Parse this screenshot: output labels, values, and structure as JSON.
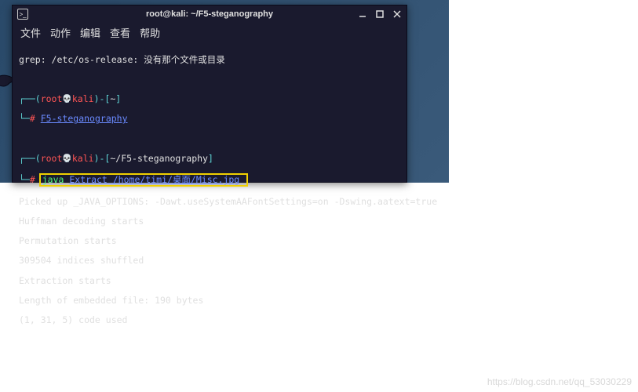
{
  "window": {
    "title": "root@kali: ~/F5-steganography"
  },
  "menu": {
    "file": "文件",
    "action": "动作",
    "edit": "编辑",
    "view": "查看",
    "help": "帮助"
  },
  "terminal": {
    "grep_line": "grep: /etc/os-release: 没有那个文件或目录",
    "prompt1": {
      "user": "root",
      "host": "kali",
      "path": "~",
      "command_prefix": "#",
      "command": "F5-steganography"
    },
    "prompt2": {
      "user": "root",
      "host": "kali",
      "path": "~/F5-steganography",
      "command_prefix": "#",
      "command_java": "java",
      "command_rest": "Extract /home/timi/桌面/Misc.jpg"
    },
    "output": {
      "l1": "Picked up _JAVA_OPTIONS: -Dawt.useSystemAAFontSettings=on -Dswing.aatext=true",
      "l2": "Huffman decoding starts",
      "l3": "Permutation starts",
      "l4": "309504 indices shuffled",
      "l5": "Extraction starts",
      "l6": "Length of embedded file: 190 bytes",
      "l7": "(1, 31, 5) code used"
    }
  },
  "watermark": "https://blog.csdn.net/qq_53030229"
}
